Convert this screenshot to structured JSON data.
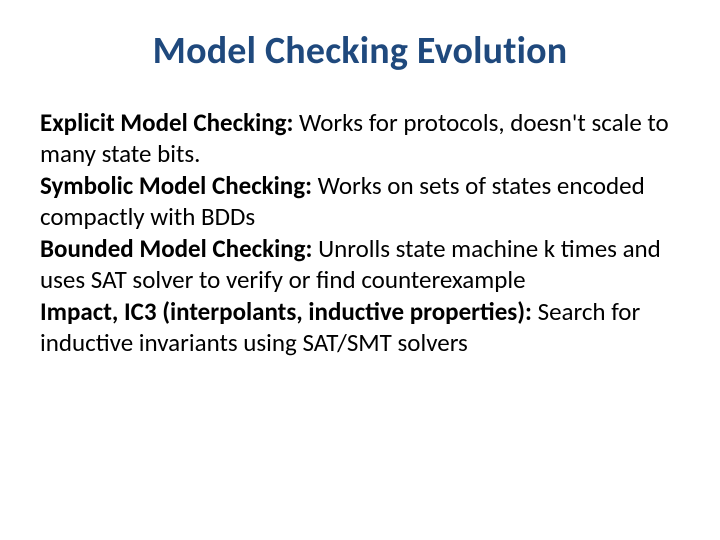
{
  "title": "Model Checking Evolution",
  "items": [
    {
      "lead": "Explicit Model Checking:",
      "text": "  Works for protocols, doesn't scale to many state bits."
    },
    {
      "lead": "Symbolic Model Checking:",
      "text": " Works on sets of states encoded compactly with BDDs"
    },
    {
      "lead": "Bounded Model Checking:",
      "text": " Unrolls state machine k times and uses SAT solver to verify or find counterexample"
    },
    {
      "lead": "Impact, IC3 (interpolants, inductive properties):",
      "text": " Search for inductive invariants using SAT/SMT solvers"
    }
  ]
}
